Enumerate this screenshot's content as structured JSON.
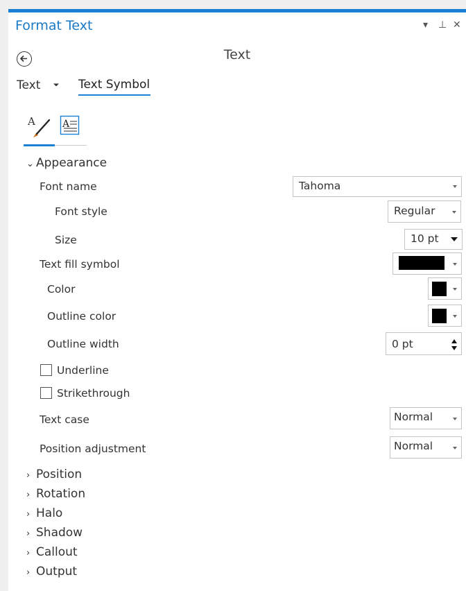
{
  "pane": {
    "title": "Format Text",
    "controls": {
      "menu": "▾",
      "pin": "⊥",
      "close": "✕"
    }
  },
  "heading": "Text",
  "breadcrumb": {
    "parent": "Text",
    "current": "Text Symbol"
  },
  "tabs": [
    {
      "icon": "symbol-brush-icon",
      "selected": true
    },
    {
      "icon": "text-properties-icon",
      "selected": false
    }
  ],
  "appearance": {
    "header": "Appearance",
    "font_name": {
      "label": "Font name",
      "value": "Tahoma"
    },
    "font_style": {
      "label": "Font style",
      "value": "Regular"
    },
    "size": {
      "label": "Size",
      "value": "10 pt"
    },
    "text_fill_symbol": {
      "label": "Text fill symbol",
      "color": "#000000"
    },
    "color": {
      "label": "Color",
      "value": "#000000"
    },
    "outline_color": {
      "label": "Outline color",
      "value": "#000000"
    },
    "outline_width": {
      "label": "Outline width",
      "value": "0 pt"
    },
    "underline": {
      "label": "Underline",
      "checked": false
    },
    "strikethrough": {
      "label": "Strikethrough",
      "checked": false
    },
    "text_case": {
      "label": "Text case",
      "value": "Normal"
    },
    "position_adjustment": {
      "label": "Position adjustment",
      "value": "Normal"
    }
  },
  "sections": [
    "Position",
    "Rotation",
    "Halo",
    "Shadow",
    "Callout",
    "Output"
  ],
  "colors": {
    "accent": "#1a80d4",
    "title": "#1a7ac8"
  }
}
